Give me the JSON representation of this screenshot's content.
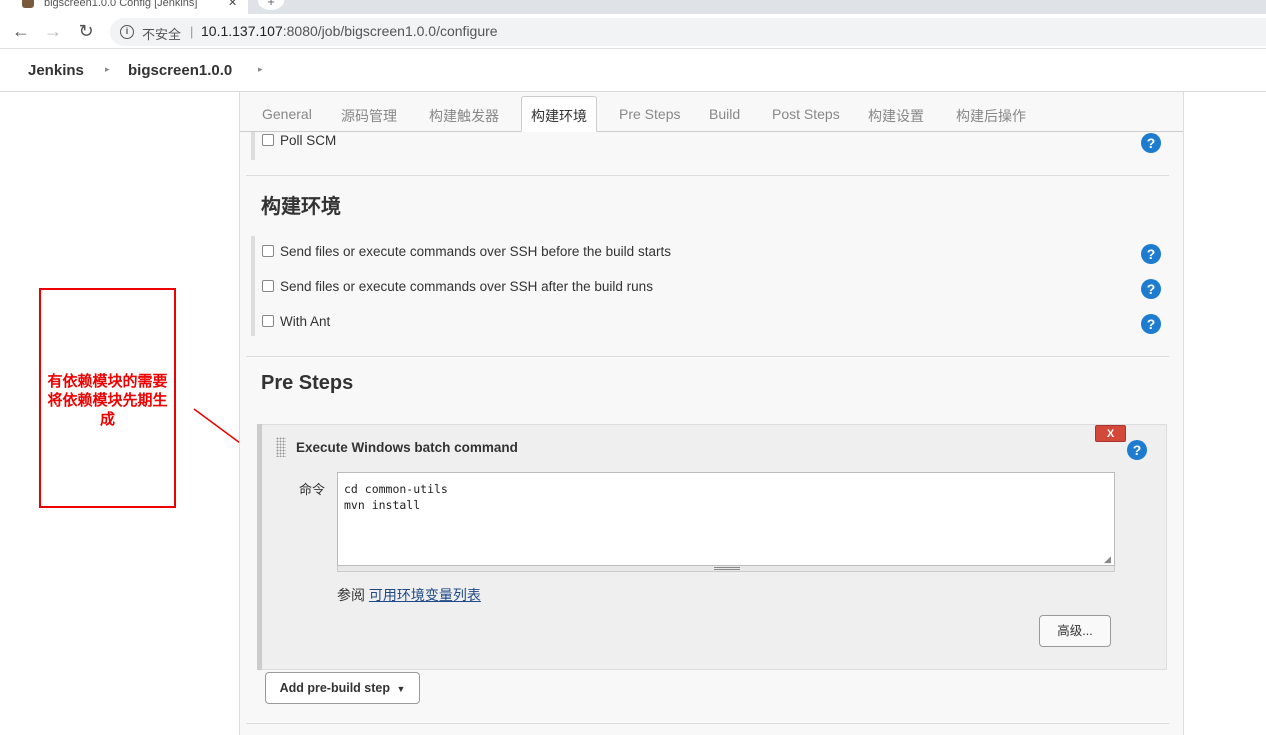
{
  "browser": {
    "tab_title": "bigscreen1.0.0 Config [Jenkins]",
    "tab_close": "✕",
    "new_tab": "+",
    "security_label": "不安全",
    "separator": "|",
    "url_host": "10.1.137.107",
    "url_path": ":8080/job/bigscreen1.0.0/configure"
  },
  "breadcrumbs": {
    "items": [
      "Jenkins",
      "bigscreen1.0.0"
    ],
    "arrow": "▸"
  },
  "config_tabs": [
    "General",
    "源码管理",
    "构建触发器",
    "构建环境",
    "Pre Steps",
    "Build",
    "Post Steps",
    "构建设置",
    "构建后操作"
  ],
  "active_tab": "构建环境",
  "trigger_section": {
    "poll_scm_label": "Poll SCM"
  },
  "build_env": {
    "title": "构建环境",
    "options": [
      "Send files or execute commands over SSH before the build starts",
      "Send files or execute commands over SSH after the build runs",
      "With Ant"
    ]
  },
  "pre_steps": {
    "title": "Pre Steps",
    "step_title": "Execute Windows batch command",
    "delete_label": "X",
    "command_label": "命令",
    "command_value": "cd common-utils\nmvn install",
    "see_also_prefix": "参阅",
    "see_also_link": "可用环境变量列表",
    "advanced_button": "高级...",
    "add_step_button": "Add pre-build step"
  },
  "help_symbol": "?",
  "annotation": {
    "text": "有依赖模块的需要将依赖模块先期生成",
    "color": "#e00000"
  },
  "colors": {
    "help_blue": "#1d7ccf",
    "delete_red": "#d24939"
  }
}
